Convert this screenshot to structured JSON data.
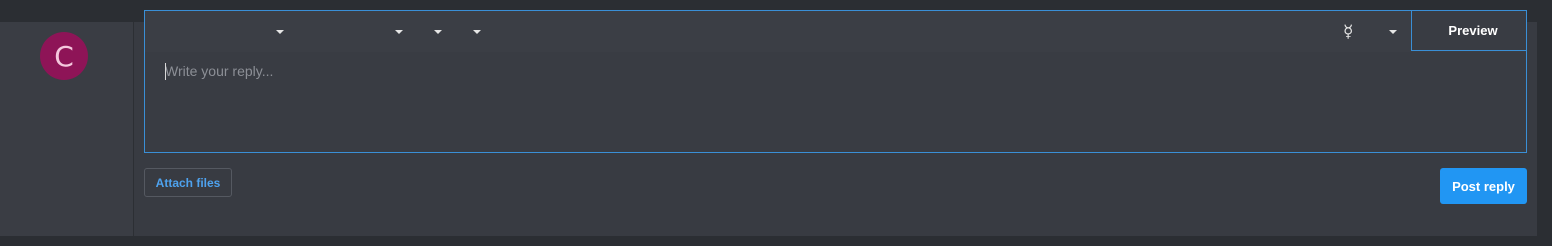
{
  "user": {
    "avatar_letter": "C",
    "avatar_color": "#8e1457"
  },
  "editor": {
    "toolbar": {
      "dropdowns": [
        "chevron-down-icon",
        "chevron-down-icon",
        "chevron-down-icon",
        "chevron-down-icon",
        "chevron-down-icon"
      ],
      "special_symbol": "☿",
      "preview_label": "Preview"
    },
    "reply": {
      "value": "",
      "placeholder": "Write your reply..."
    },
    "border_color": "#3a8fd6"
  },
  "actions": {
    "attach_label": "Attach files",
    "post_label": "Post reply",
    "accent_color": "#2196f3"
  }
}
